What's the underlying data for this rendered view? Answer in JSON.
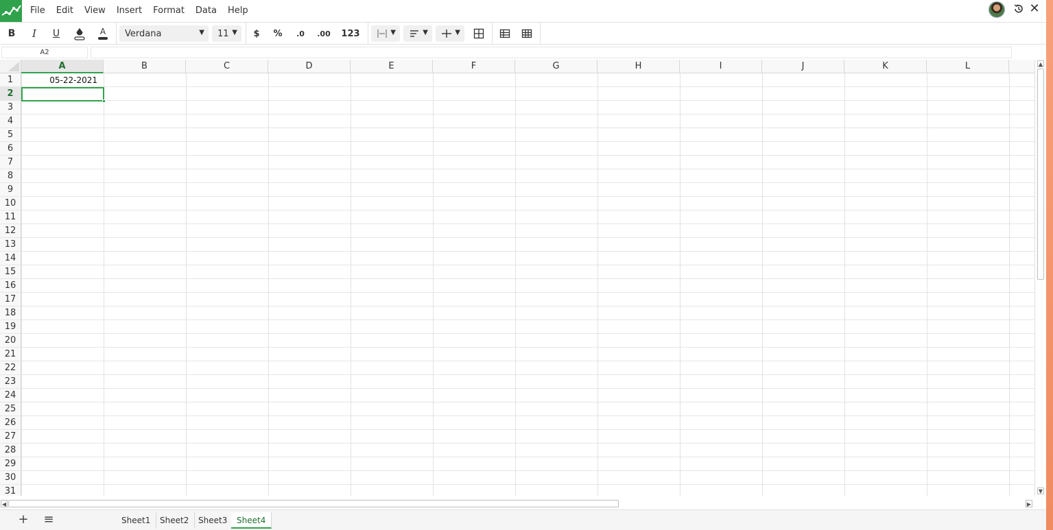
{
  "menubar": {
    "items": [
      "File",
      "Edit",
      "View",
      "Insert",
      "Format",
      "Data",
      "Help"
    ]
  },
  "toolbar": {
    "bold": "B",
    "italic": "I",
    "underline": "U",
    "font_family": "Verdana",
    "font_size": "11",
    "currency": "$",
    "percent": "%",
    "decimal_decrease": ".0",
    "decimal_increase": ".00",
    "number_format": "123"
  },
  "formula_bar": {
    "cell_reference": "A2",
    "formula_value": ""
  },
  "grid": {
    "columns": [
      "A",
      "B",
      "C",
      "D",
      "E",
      "F",
      "G",
      "H",
      "I",
      "J",
      "K",
      "L"
    ],
    "rows": [
      "1",
      "2",
      "3",
      "4",
      "5",
      "6",
      "7",
      "8",
      "9",
      "10",
      "11",
      "12",
      "13",
      "14",
      "15",
      "16",
      "17",
      "18",
      "19",
      "20",
      "21",
      "22",
      "23",
      "24",
      "25",
      "26",
      "27",
      "28",
      "29",
      "30",
      "31"
    ],
    "active_column": "A",
    "active_row": "2",
    "cells": {
      "A1": "05-22-2021"
    }
  },
  "sheets": {
    "tabs": [
      "Sheet1",
      "Sheet2",
      "Sheet3",
      "Sheet4"
    ],
    "active": "Sheet4"
  },
  "colors": {
    "accent": "#31a24c",
    "accent_dark": "#1e6f2e",
    "side_strip": "#f08a60"
  }
}
